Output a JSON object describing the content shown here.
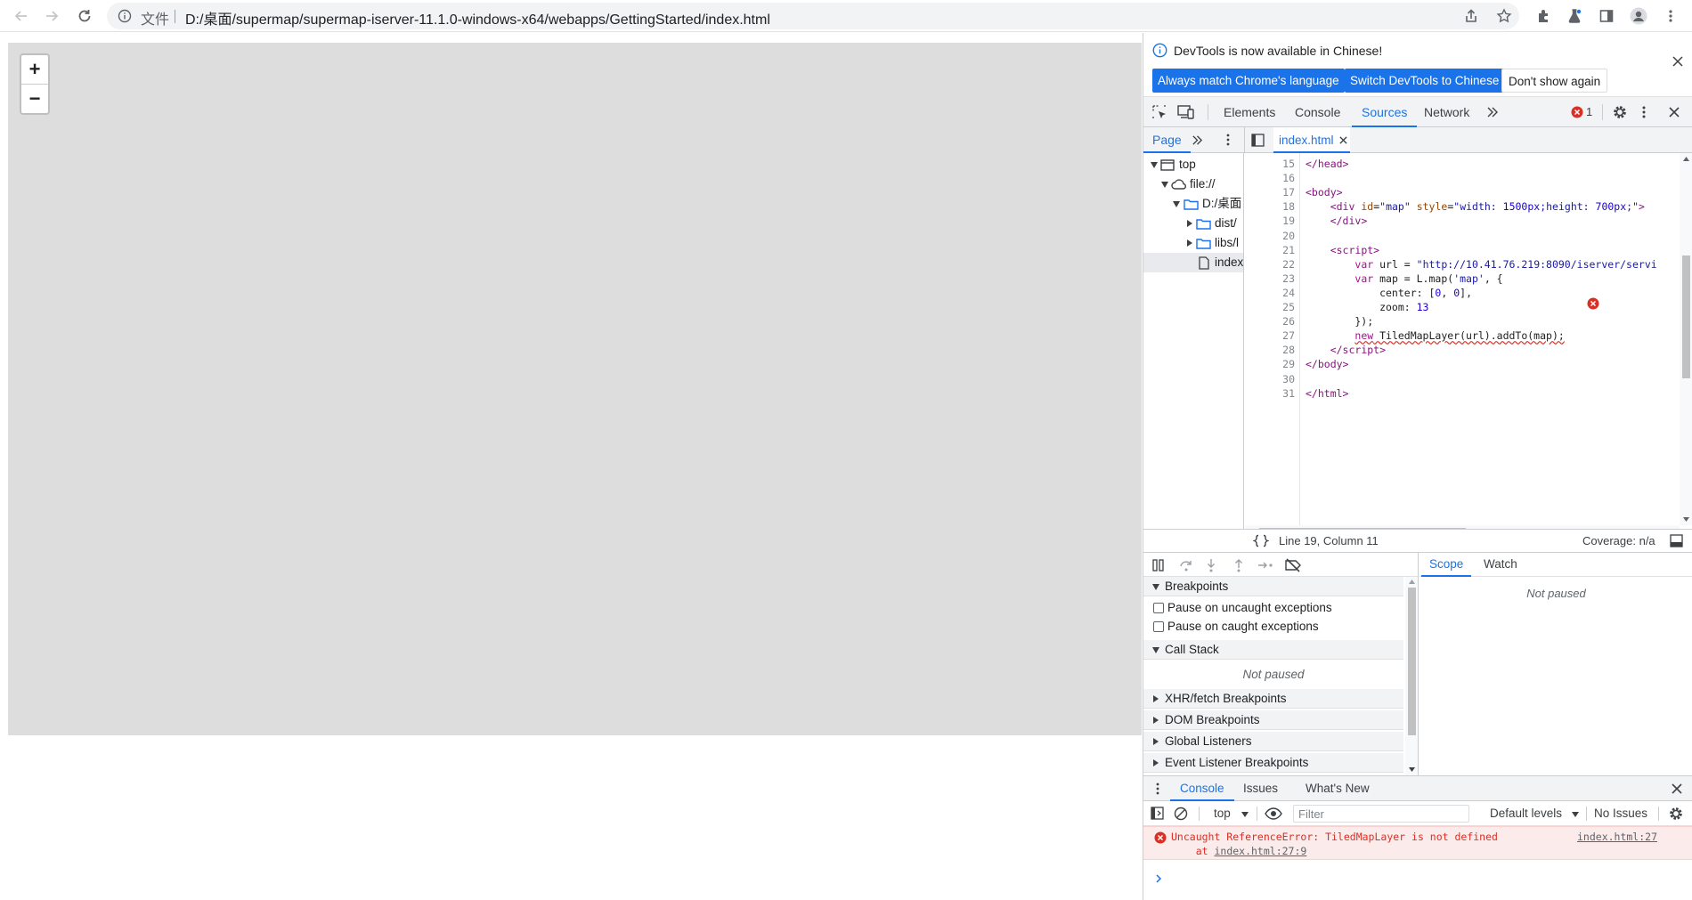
{
  "browser": {
    "file_label": "文件",
    "url": "D:/桌面/supermap/supermap-iserver-11.1.0-windows-x64/webapps/GettingStarted/index.html"
  },
  "map": {
    "zoom_in": "+",
    "zoom_out": "−"
  },
  "devtools": {
    "infobar": {
      "message": "DevTools is now available in Chinese!",
      "btn_match": "Always match Chrome's language",
      "btn_switch": "Switch DevTools to Chinese",
      "btn_dismiss": "Don't show again"
    },
    "tabs": [
      "Elements",
      "Console",
      "Sources",
      "Network"
    ],
    "error_count": "1",
    "navigator": {
      "page_tab": "Page",
      "open_file": "index.html",
      "tree": [
        "top",
        "file://",
        "D:/桌面",
        "dist/",
        "libs/l",
        "index"
      ]
    },
    "code_lines": [
      {
        "n": "15",
        "html": "<span class='t-tag'>&lt;/head&gt;</span>"
      },
      {
        "n": "16",
        "html": ""
      },
      {
        "n": "17",
        "html": "<span class='t-tag'>&lt;body&gt;</span>"
      },
      {
        "n": "18",
        "html": "    <span class='t-tag'>&lt;div</span> <span class='t-attr'>id</span>=<span class='t-val'>\"map\"</span> <span class='t-attr'>style</span>=<span class='t-val'>\"width: <span class='t-num'>1500px</span>;height: <span class='t-num'>700px</span>;\"</span><span class='t-tag'>&gt;</span>"
      },
      {
        "n": "19",
        "html": "    <span class='t-tag'>&lt;/div&gt;</span>"
      },
      {
        "n": "20",
        "html": ""
      },
      {
        "n": "21",
        "html": "    <span class='t-tag'>&lt;script&gt;</span>"
      },
      {
        "n": "22",
        "html": "        <span class='t-kw'>var</span> url = <span class='t-val'>\"http://10.41.76.219:8090/iserver/servi</span>"
      },
      {
        "n": "23",
        "html": "        <span class='t-kw'>var</span> map = L.map(<span class='t-val'>'map'</span>, {"
      },
      {
        "n": "24",
        "html": "            center: [<span class='t-num'>0</span>, <span class='t-num'>0</span>],"
      },
      {
        "n": "25",
        "html": "            zoom: <span class='t-num'>13</span>"
      },
      {
        "n": "26",
        "html": "        });"
      },
      {
        "n": "27",
        "html": "        <span style='text-decoration:underline wavy #d93025;'><span class='t-kw'>new</span> TiledMapLayer(url).addTo(map);</span>"
      },
      {
        "n": "28",
        "html": "    <span class='t-tag'>&lt;/script&gt;</span>"
      },
      {
        "n": "29",
        "html": "<span class='t-tag'>&lt;/body&gt;</span>"
      },
      {
        "n": "30",
        "html": ""
      },
      {
        "n": "31",
        "html": "<span class='t-tag'>&lt;/html&gt;</span>"
      }
    ],
    "status": {
      "position": "Line 19, Column 11",
      "coverage": "Coverage: n/a"
    },
    "debugger": {
      "breakpoints": "Breakpoints",
      "pause_uncaught": "Pause on uncaught exceptions",
      "pause_caught": "Pause on caught exceptions",
      "call_stack": "Call Stack",
      "not_paused": "Not paused",
      "xhr": "XHR/fetch Breakpoints",
      "dom": "DOM Breakpoints",
      "global": "Global Listeners",
      "event": "Event Listener Breakpoints",
      "scope_tab": "Scope",
      "watch_tab": "Watch",
      "scope_status": "Not paused"
    },
    "drawer": {
      "tabs": [
        "Console",
        "Issues",
        "What's New"
      ],
      "context": "top",
      "filter_placeholder": "Filter",
      "levels": "Default levels",
      "issues": "No Issues",
      "error_message": "Uncaught ReferenceError: TiledMapLayer is not defined",
      "error_at": "    at ",
      "error_at_link": "index.html:27:9",
      "error_source": "index.html:27"
    }
  }
}
